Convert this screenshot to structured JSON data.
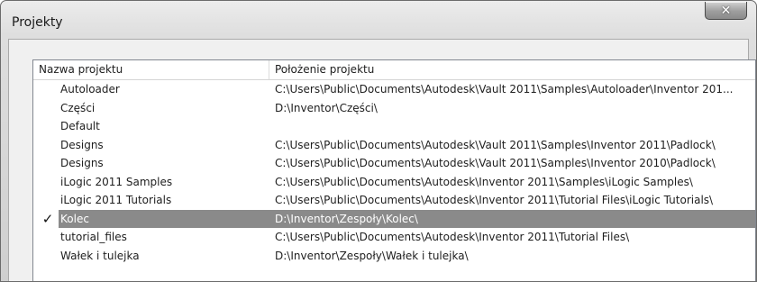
{
  "window": {
    "title": "Projekty",
    "close_glyph": "✕"
  },
  "columns": {
    "name": "Nazwa projektu",
    "location": "Położenie projektu"
  },
  "rows": [
    {
      "name": "Autoloader",
      "path": "C:\\Users\\Public\\Documents\\Autodesk\\Vault 2011\\Samples\\Autoloader\\Inventor 201...",
      "active": false
    },
    {
      "name": "Części",
      "path": "D:\\Inventor\\Części\\",
      "active": false
    },
    {
      "name": "Default",
      "path": "",
      "active": false
    },
    {
      "name": "Designs",
      "path": "C:\\Users\\Public\\Documents\\Autodesk\\Vault 2011\\Samples\\Inventor 2011\\Padlock\\",
      "active": false
    },
    {
      "name": "Designs",
      "path": "C:\\Users\\Public\\Documents\\Autodesk\\Vault 2011\\Samples\\Inventor 2010\\Padlock\\",
      "active": false
    },
    {
      "name": "iLogic 2011 Samples",
      "path": "C:\\Users\\Public\\Documents\\Autodesk\\Inventor 2011\\Samples\\iLogic Samples\\",
      "active": false
    },
    {
      "name": "iLogic 2011 Tutorials",
      "path": "C:\\Users\\Public\\Documents\\Autodesk\\Inventor 2011\\Tutorial Files\\iLogic Tutorials\\",
      "active": false
    },
    {
      "name": "Kolec",
      "path": "D:\\Inventor\\Zespoły\\Kolec\\",
      "active": true,
      "check": "✓"
    },
    {
      "name": "tutorial_files",
      "path": "C:\\Users\\Public\\Documents\\Autodesk\\Inventor 2011\\Tutorial Files\\",
      "active": false
    },
    {
      "name": "Wałek i tulejka",
      "path": "D:\\Inventor\\Zespoły\\Wałek i tulejka\\",
      "active": false
    }
  ],
  "colors": {
    "selection": "#8a8a8a",
    "close_button": "#9e9e9e"
  }
}
